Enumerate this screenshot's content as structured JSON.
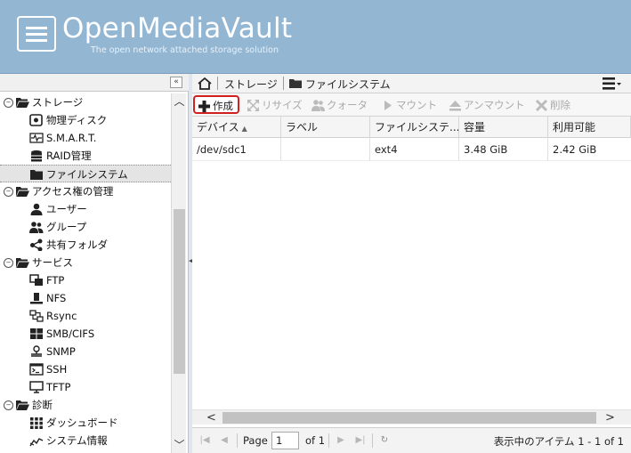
{
  "brand": {
    "title": "OpenMediaVault",
    "subtitle": "The open network attached storage solution"
  },
  "nav": {
    "collapse_label": "«",
    "items": [
      {
        "type": "category",
        "label": "ストレージ",
        "expander": "⊝"
      },
      {
        "type": "child",
        "label": "物理ディスク",
        "icon": "disk-icon"
      },
      {
        "type": "child",
        "label": "S.M.A.R.T.",
        "icon": "heartbeat-icon"
      },
      {
        "type": "child",
        "label": "RAID管理",
        "icon": "database-icon"
      },
      {
        "type": "child",
        "label": "ファイルシステム",
        "icon": "folder-icon",
        "selected": true
      },
      {
        "type": "category",
        "label": "アクセス権の管理",
        "expander": "⊝"
      },
      {
        "type": "child",
        "label": "ユーザー",
        "icon": "user-icon"
      },
      {
        "type": "child",
        "label": "グループ",
        "icon": "group-icon"
      },
      {
        "type": "child",
        "label": "共有フォルダ",
        "icon": "share-icon"
      },
      {
        "type": "category",
        "label": "サービス",
        "expander": "⊝"
      },
      {
        "type": "child",
        "label": "FTP",
        "icon": "ftp-icon"
      },
      {
        "type": "child",
        "label": "NFS",
        "icon": "nfs-icon"
      },
      {
        "type": "child",
        "label": "Rsync",
        "icon": "rsync-icon"
      },
      {
        "type": "child",
        "label": "SMB/CIFS",
        "icon": "windows-icon"
      },
      {
        "type": "child",
        "label": "SNMP",
        "icon": "network-icon"
      },
      {
        "type": "child",
        "label": "SSH",
        "icon": "terminal-icon"
      },
      {
        "type": "child",
        "label": "TFTP",
        "icon": "monitor-icon"
      },
      {
        "type": "category",
        "label": "診断",
        "expander": "⊝"
      },
      {
        "type": "child",
        "label": "ダッシュボード",
        "icon": "dashboard-icon"
      },
      {
        "type": "child",
        "label": "システム情報",
        "icon": "chart-icon"
      }
    ]
  },
  "breadcrumb": {
    "first": "ストレージ",
    "second": "ファイルシステム"
  },
  "toolbar": {
    "create": "作成",
    "resize": "リサイズ",
    "quota": "クォータ",
    "mount": "マウント",
    "unmount": "アンマウント",
    "delete": "削除"
  },
  "grid": {
    "columns": [
      "デバイス",
      "ラベル",
      "ファイルシステ...",
      "容量",
      "利用可能"
    ],
    "sort_indicator": "▲",
    "rows": [
      {
        "device": "/dev/sdc1",
        "label": "",
        "filesystem": "ext4",
        "capacity": "3.48 GiB",
        "available": "2.42 GiB"
      }
    ]
  },
  "pager": {
    "page_label": "Page",
    "page_value": "1",
    "of_label": "of 1",
    "status": "表示中のアイテム 1 - 1 of 1"
  },
  "colors": {
    "header_bg": "#93b6d3",
    "highlight_border": "#d0201f"
  }
}
